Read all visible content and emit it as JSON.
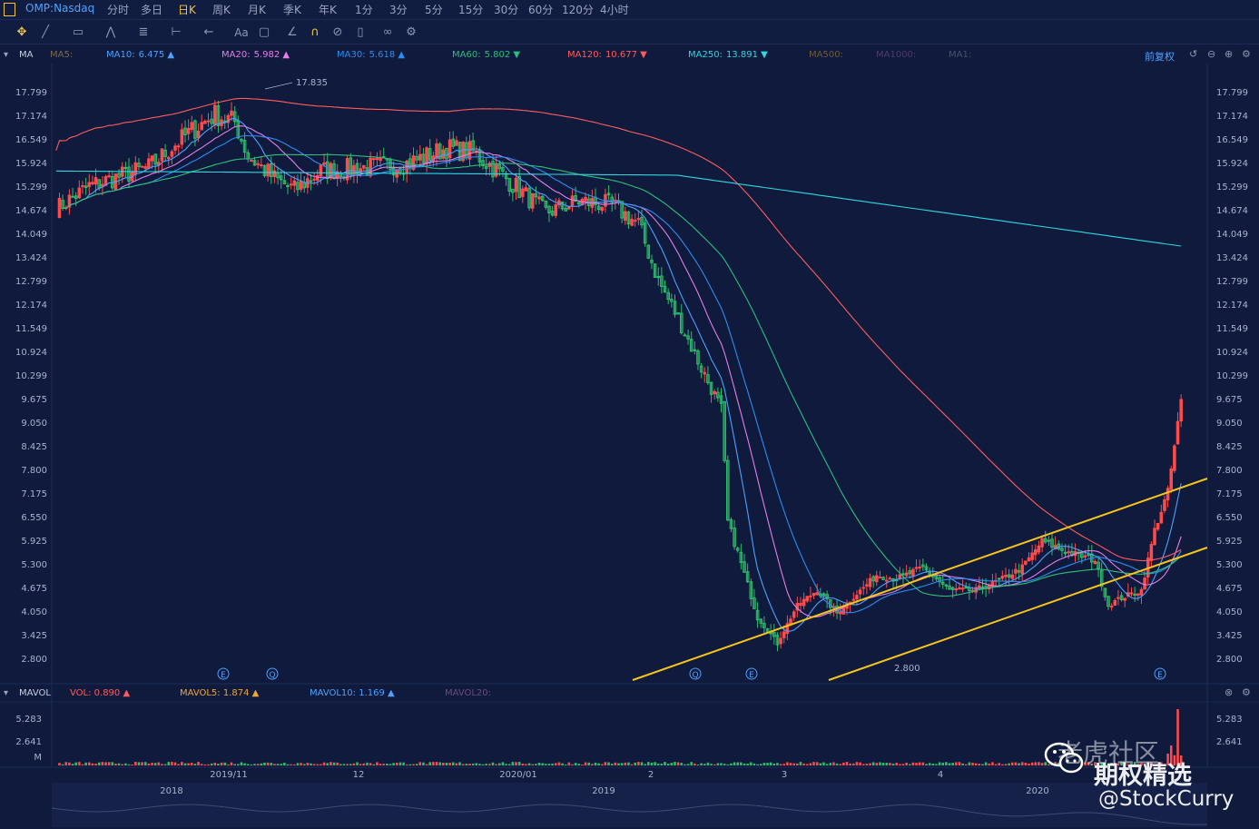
{
  "header": {
    "symbol": "OMP:Nasdaq",
    "tabs": [
      "分时",
      "多日",
      "日K",
      "周K",
      "月K",
      "季K",
      "年K",
      "1分",
      "3分",
      "5分",
      "15分",
      "30分",
      "60分",
      "120分",
      "4小时"
    ],
    "active_tab": "日K"
  },
  "toolbar": {
    "tools": [
      "move-icon",
      "line-tool-icon",
      "rect-tool-icon",
      "polyline-tool-icon",
      "fib-tool-icon",
      "range-tool-icon",
      "arrow-tool-icon",
      "text-tool-icon",
      "comment-tool-icon",
      "ruler-icon",
      "magnet-icon",
      "hide-icon",
      "delete-icon",
      "link-icon",
      "settings-icon"
    ],
    "text_tool_label": "Aa"
  },
  "ma_panel": {
    "label": "MA",
    "fq_label": "前复权",
    "items": [
      {
        "name": "MA5:",
        "value": "",
        "color": "#7a6a52"
      },
      {
        "name": "MA10:",
        "value": "6.475",
        "color": "#4da2ff",
        "arrow": "▲"
      },
      {
        "name": "MA20:",
        "value": "5.982",
        "color": "#e57fe8",
        "arrow": "▲"
      },
      {
        "name": "MA30:",
        "value": "5.618",
        "color": "#2e8cf0",
        "arrow": "▲"
      },
      {
        "name": "MA60:",
        "value": "5.802",
        "color": "#2fbf7a",
        "arrow": "▼"
      },
      {
        "name": "MA120:",
        "value": "10.677",
        "color": "#ff5d5d",
        "arrow": "▼"
      },
      {
        "name": "MA250:",
        "value": "13.891",
        "color": "#2fd8e0",
        "arrow": "▼"
      },
      {
        "name": "MA500:",
        "value": "",
        "color": "#6e5c3a"
      },
      {
        "name": "MA1000:",
        "value": "",
        "color": "#4e3b6e"
      },
      {
        "name": "MA1:",
        "value": "",
        "color": "#4a5170"
      }
    ]
  },
  "price_axis": {
    "ticks": [
      "17.799",
      "17.174",
      "16.549",
      "15.924",
      "15.299",
      "14.674",
      "14.049",
      "13.424",
      "12.799",
      "12.174",
      "11.549",
      "10.924",
      "10.299",
      "9.675",
      "9.050",
      "8.425",
      "7.800",
      "7.175",
      "6.550",
      "5.925",
      "5.300",
      "4.675",
      "4.050",
      "3.425",
      "2.800"
    ],
    "high_marker": "17.835",
    "low_marker": "2.800"
  },
  "event_markers": [
    "E",
    "Q",
    "Q",
    "E",
    "E"
  ],
  "vol_panel": {
    "label": "MAVOL",
    "items": [
      {
        "name": "VOL:",
        "value": "0.890",
        "color": "#ff5d5d",
        "arrow": "▲"
      },
      {
        "name": "MAVOL5:",
        "value": "1.874",
        "color": "#f0a53a",
        "arrow": "▲"
      },
      {
        "name": "MAVOL10:",
        "value": "1.169",
        "color": "#4da2ff",
        "arrow": "▲"
      },
      {
        "name": "MAVOL20:",
        "value": "",
        "color": "#6e4a7e"
      }
    ],
    "ticks": [
      "5.283",
      "2.641",
      "M"
    ],
    "right_ticks": [
      "5.283",
      "2.641"
    ]
  },
  "x_axis": {
    "labels": [
      "2019/11",
      "12",
      "2020/01",
      "2",
      "3",
      "4"
    ]
  },
  "overview_axis": {
    "labels": [
      "2018",
      "2019",
      "2020"
    ]
  },
  "watermark": {
    "line1": "老虎社区",
    "line2": "期权精选",
    "line3": "@StockCurry"
  },
  "colors": {
    "up": "#ff4b4b",
    "down": "#2fbf6a",
    "channel": "#f5c518",
    "bg": "#0f1a3c"
  }
}
